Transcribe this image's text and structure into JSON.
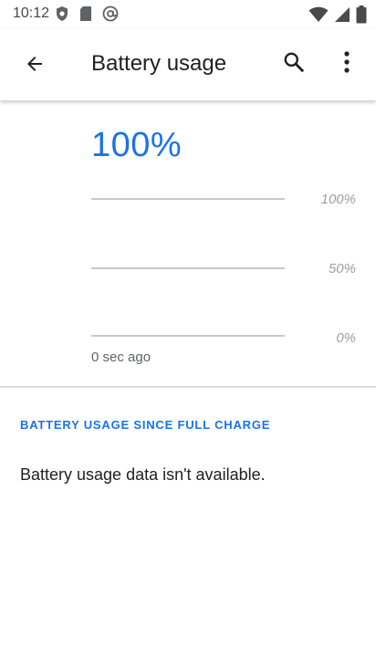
{
  "status_bar": {
    "time": "10:12",
    "left_icons": [
      "shield-icon",
      "sd-card-icon",
      "at-sign-icon"
    ],
    "right_icons": [
      "wifi-icon",
      "cell-signal-icon",
      "battery-icon"
    ]
  },
  "app_bar": {
    "title": "Battery usage",
    "back_icon": "arrow-back-icon",
    "search_icon": "search-icon",
    "more_icon": "more-vert-icon"
  },
  "graph": {
    "battery_level": "100%",
    "axis_labels": [
      "100%",
      "50%",
      "0%"
    ],
    "time_label": "0 sec ago"
  },
  "usage_section": {
    "header": "BATTERY USAGE SINCE FULL CHARGE",
    "message": "Battery usage data isn't available."
  },
  "colors": {
    "accent": "#1a73e8",
    "gridline": "#c8c8c8",
    "axis_text": "#9e9e9e"
  }
}
